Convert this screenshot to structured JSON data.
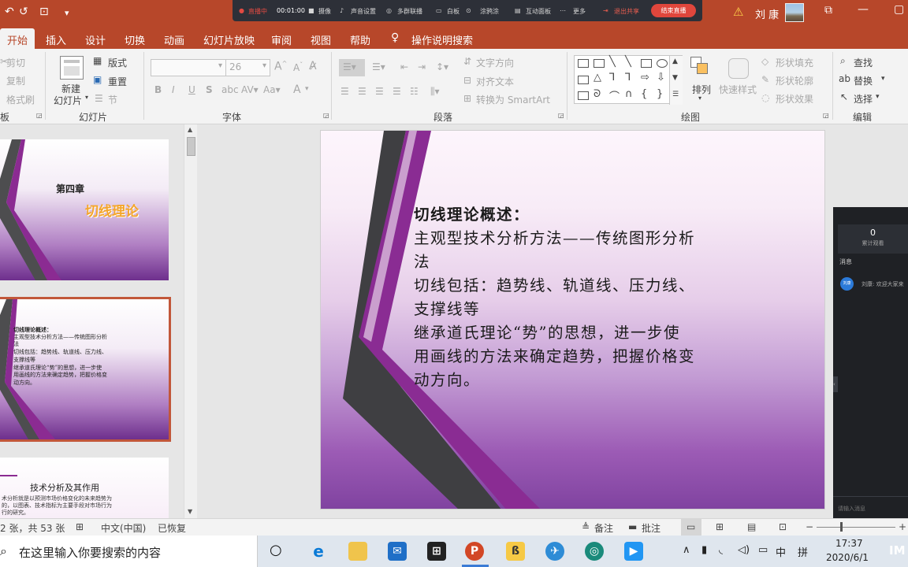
{
  "titlebar": {
    "quick_access": [
      "↶",
      "↺",
      "⊡",
      "▾"
    ],
    "meeting_bar": {
      "live": "直播中",
      "timer": "00:01:00",
      "camera": "摄像",
      "audio": "声音设置",
      "invite": "多群联播",
      "whiteboard": "白板",
      "doodle": "涂鸦涂",
      "interact": "互动面板",
      "more": "更多",
      "exit_share": "退出共享",
      "end_live": "结束直播"
    },
    "user_name": "刘 康",
    "warning_icon": "⚠"
  },
  "tabs": [
    "开始",
    "插入",
    "设计",
    "切换",
    "动画",
    "幻灯片放映",
    "审阅",
    "视图",
    "帮助"
  ],
  "tell_me": "操作说明搜索",
  "ribbon": {
    "clipboard": {
      "cut": "剪切",
      "copy": "复制",
      "format_painter": "格式刷",
      "label": "板"
    },
    "slides": {
      "new_slide_line1": "新建",
      "new_slide_line2": "幻灯片",
      "layout": "版式",
      "reset": "重置",
      "section": "节",
      "label": "幻灯片"
    },
    "font": {
      "size": "26",
      "bold": "B",
      "italic": "I",
      "underline": "U",
      "shadow": "S",
      "label": "字体"
    },
    "paragraph": {
      "text_direction": "文字方向",
      "align_text": "对齐文本",
      "smartart": "转换为 SmartArt",
      "label": "段落"
    },
    "drawing": {
      "arrange": "排列",
      "quick_styles": "快速样式",
      "shape_fill": "形状填充",
      "shape_outline": "形状轮廓",
      "shape_effects": "形状效果",
      "label": "绘图"
    },
    "editing": {
      "find": "查找",
      "replace": "替换",
      "select": "选择",
      "label": "编辑"
    }
  },
  "thumbnails": {
    "slide1": {
      "chapter": "第四章",
      "subtitle": "切线理论"
    },
    "slide2": {
      "lines": [
        "切线理论概述：",
        "主观型技术分析方法——传统图形分析",
        "法",
        "切线包括：趋势线、轨道线、压力线、",
        "支撑线等",
        "继承道氏理论“势”的思想，进一步使",
        "用画线的方法来确定趋势，把握价格变",
        "动方向。"
      ]
    },
    "slide3": {
      "title": "技术分析及其作用",
      "lines": [
        "术分析就是以预测市场价格变化的未来趋势为",
        "的，以图表、技术指标为主要手段对市场行为",
        "行的研究。"
      ]
    }
  },
  "slide": {
    "title": "切线理论概述：",
    "lines": [
      "主观型技术分析方法——传统图形分析",
      "法",
      "切线包括：趋势线、轨道线、压力线、",
      "支撑线等",
      "继承道氏理论“势”的思想，进一步使",
      "用画线的方法来确定趋势，把握价格变",
      "动方向。"
    ]
  },
  "chat": {
    "viewer_count": "0",
    "viewer_label": "累计观看",
    "messages_label": "消息",
    "avatar": "刘康",
    "message": "刘康: 欢迎大家来",
    "input_placeholder": "请输入消息"
  },
  "statusbar": {
    "slide_info": "2 张，共 53 张",
    "language": "中文(中国)",
    "recovered": "已恢复",
    "notes": "备注",
    "comments": "批注"
  },
  "taskbar": {
    "search_placeholder": "在这里输入你要搜索的内容",
    "time": "17:37",
    "date": "2020/6/1",
    "ime": "中",
    "ime2": "拼"
  }
}
